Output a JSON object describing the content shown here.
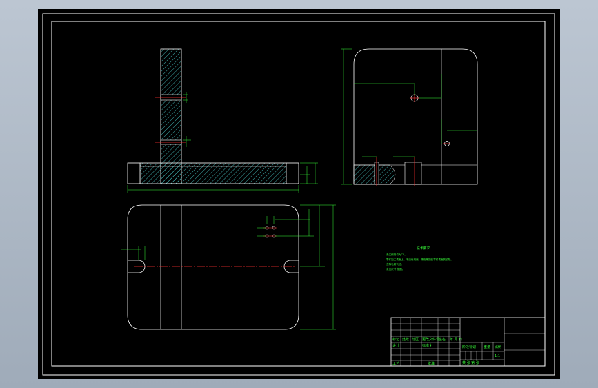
{
  "notes": {
    "title": "技术要求",
    "lines": [
      "未注倒角均为C1。",
      "零件加工表面上，不应有划痕、擦伤等损伤零件表面的缺陷。",
      "去除毛刺飞边。",
      "未注尺寸 按图。"
    ]
  },
  "title_block": {
    "designer_label": "设计",
    "process_label": "工艺",
    "marker_label": "标记",
    "count_label": "处数",
    "zone_label": "分区",
    "change_doc_label": "更改文件号",
    "signature_label": "签名",
    "date_label": "年 月 日",
    "standard_label": "标准化",
    "approve_label": "批准",
    "stage_label": "阶段标记",
    "weight_label": "重量",
    "scale_label": "比例",
    "scale_value": "1:1",
    "sheet_label": "共   张   第   张"
  },
  "colors": {
    "background": "#000000",
    "line": "#ffffff",
    "dimension": "#39ff3a",
    "centerline": "#ff3030",
    "hatch": "#4fd8d8"
  }
}
